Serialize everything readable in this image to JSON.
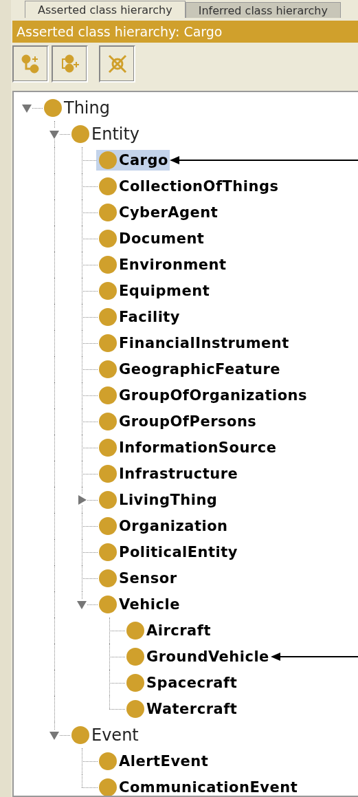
{
  "tabs": [
    {
      "label": "Asserted class hierarchy",
      "selected": true
    },
    {
      "label": "Inferred class hierarchy",
      "selected": false
    }
  ],
  "header": {
    "title": "Asserted class hierarchy: Cargo"
  },
  "toolbar": [
    {
      "kind": "add-subclass"
    },
    {
      "kind": "add-sibling"
    },
    {
      "kind": "delete"
    }
  ],
  "tree": [
    {
      "label": "Thing",
      "bold": false,
      "expanded": true,
      "selected": false,
      "annotated": false,
      "children": [
        {
          "label": "Entity",
          "bold": false,
          "expanded": true,
          "selected": false,
          "annotated": false,
          "children": [
            {
              "label": "Cargo",
              "bold": true,
              "selected": true,
              "annotated": true
            },
            {
              "label": "CollectionOfThings",
              "bold": true,
              "selected": false,
              "annotated": false
            },
            {
              "label": "CyberAgent",
              "bold": true,
              "selected": false,
              "annotated": false
            },
            {
              "label": "Document",
              "bold": true,
              "selected": false,
              "annotated": false
            },
            {
              "label": "Environment",
              "bold": true,
              "selected": false,
              "annotated": false
            },
            {
              "label": "Equipment",
              "bold": true,
              "selected": false,
              "annotated": false
            },
            {
              "label": "Facility",
              "bold": true,
              "selected": false,
              "annotated": false
            },
            {
              "label": "FinancialInstrument",
              "bold": true,
              "selected": false,
              "annotated": false
            },
            {
              "label": "GeographicFeature",
              "bold": true,
              "selected": false,
              "annotated": false
            },
            {
              "label": "GroupOfOrganizations",
              "bold": true,
              "selected": false,
              "annotated": false
            },
            {
              "label": "GroupOfPersons",
              "bold": true,
              "selected": false,
              "annotated": false
            },
            {
              "label": "InformationSource",
              "bold": true,
              "selected": false,
              "annotated": false
            },
            {
              "label": "Infrastructure",
              "bold": true,
              "selected": false,
              "annotated": false
            },
            {
              "label": "LivingThing",
              "bold": true,
              "expanded": false,
              "selected": false,
              "annotated": false
            },
            {
              "label": "Organization",
              "bold": true,
              "selected": false,
              "annotated": false
            },
            {
              "label": "PoliticalEntity",
              "bold": true,
              "selected": false,
              "annotated": false
            },
            {
              "label": "Sensor",
              "bold": true,
              "selected": false,
              "annotated": false
            },
            {
              "label": "Vehicle",
              "bold": true,
              "expanded": true,
              "selected": false,
              "annotated": false,
              "children": [
                {
                  "label": "Aircraft",
                  "bold": true,
                  "selected": false,
                  "annotated": false
                },
                {
                  "label": "GroundVehicle",
                  "bold": true,
                  "selected": false,
                  "annotated": true
                },
                {
                  "label": "Spacecraft",
                  "bold": true,
                  "selected": false,
                  "annotated": false
                },
                {
                  "label": "Watercraft",
                  "bold": true,
                  "selected": false,
                  "annotated": false
                }
              ]
            }
          ]
        },
        {
          "label": "Event",
          "bold": false,
          "expanded": true,
          "selected": false,
          "annotated": false,
          "children": [
            {
              "label": "AlertEvent",
              "bold": true,
              "selected": false,
              "annotated": false
            },
            {
              "label": "CommunicationEvent",
              "bold": true,
              "selected": false,
              "annotated": false
            }
          ]
        }
      ]
    }
  ]
}
